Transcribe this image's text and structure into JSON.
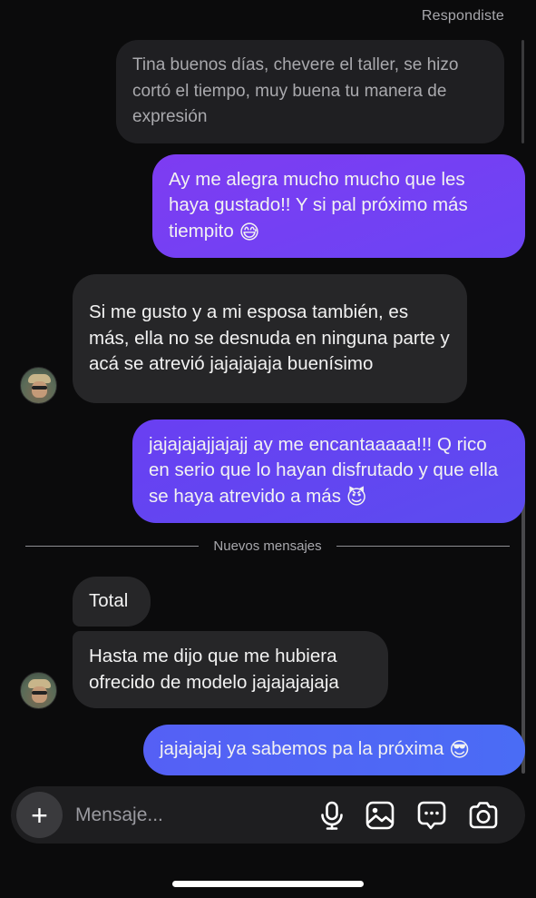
{
  "header": {
    "replied_label": "Respondiste"
  },
  "messages": {
    "quoted": "Tina buenos días, chevere el taller, se hizo cortó el tiempo, muy buena tu manera de expresión",
    "out_1": {
      "text": "Ay me alegra mucho mucho que les haya gustado!! Y si pal próximo más tiempito",
      "emoji": "😅"
    },
    "in_1": "Si me gusto y a mi esposa también, es más, ella no se desnuda en ninguna parte y acá se atrevió jajajajaja buenísimo",
    "out_2": {
      "text": "jajajajajjajajj ay me encantaaaaa!!! Q rico en serio que lo hayan disfrutado y que ella se haya atrevido a más",
      "emoji": "😈"
    },
    "in_2": "Total",
    "in_3": "Hasta me dijo que me hubiera ofrecido de modelo jajajajajaja",
    "out_3": {
      "text": "jajajajaj ya sabemos pa la próxima",
      "emoji": "😎"
    }
  },
  "divider": {
    "label": "Nuevos mensajes"
  },
  "composer": {
    "plus_label": "+",
    "placeholder": "Mensaje..."
  },
  "icons": {
    "add": "plus-icon",
    "mic": "microphone-icon",
    "gallery": "image-icon",
    "sticker": "sticker-icon",
    "camera": "camera-icon"
  },
  "colors": {
    "background": "#0b0b0c",
    "outgoing_bubble": "#7e3cf2",
    "outgoing_bubble_last": "#4a6cf5",
    "incoming_bubble": "#262628",
    "quoted_bubble": "#1f1f22"
  }
}
